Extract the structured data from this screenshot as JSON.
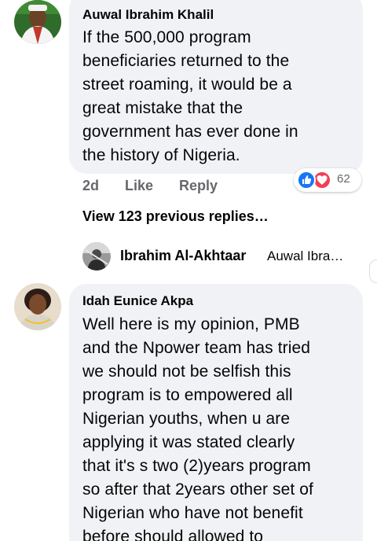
{
  "comment1": {
    "author": "Auwal Ibrahim Khalil",
    "text_lines": [
      "If the 500,000 program",
      "beneficiaries returned to the",
      "street roaming, it would be a",
      "great mistake that the",
      "government has ever done in",
      "the history of Nigeria."
    ],
    "time": "2d",
    "like_label": "Like",
    "reply_label": "Reply",
    "reaction_count": "62",
    "reaction_icons": [
      "like-icon",
      "love-icon"
    ]
  },
  "view_replies": "View 123 previous replies…",
  "reply_preview": {
    "author": "Ibrahim Al-Akhtaar",
    "text": "Auwal Ibra…"
  },
  "comment2": {
    "author": "Idah Eunice Akpa",
    "text_lines": [
      "Well here is my opinion, PMB",
      "and the Npower team has tried",
      "we should not be selfish this",
      "program is to empowered all",
      "Nigerian youths, when u are",
      "applying it was stated clearly",
      "that it's s two (2)years program",
      "so after that 2years other set of",
      "Nigerian who have not benefit",
      "before should allowed to"
    ]
  },
  "colors": {
    "bubble": "#f0f2f5",
    "secondary_text": "#65676b",
    "like_blue": "#1877f2",
    "love_red": "#f33e58"
  }
}
